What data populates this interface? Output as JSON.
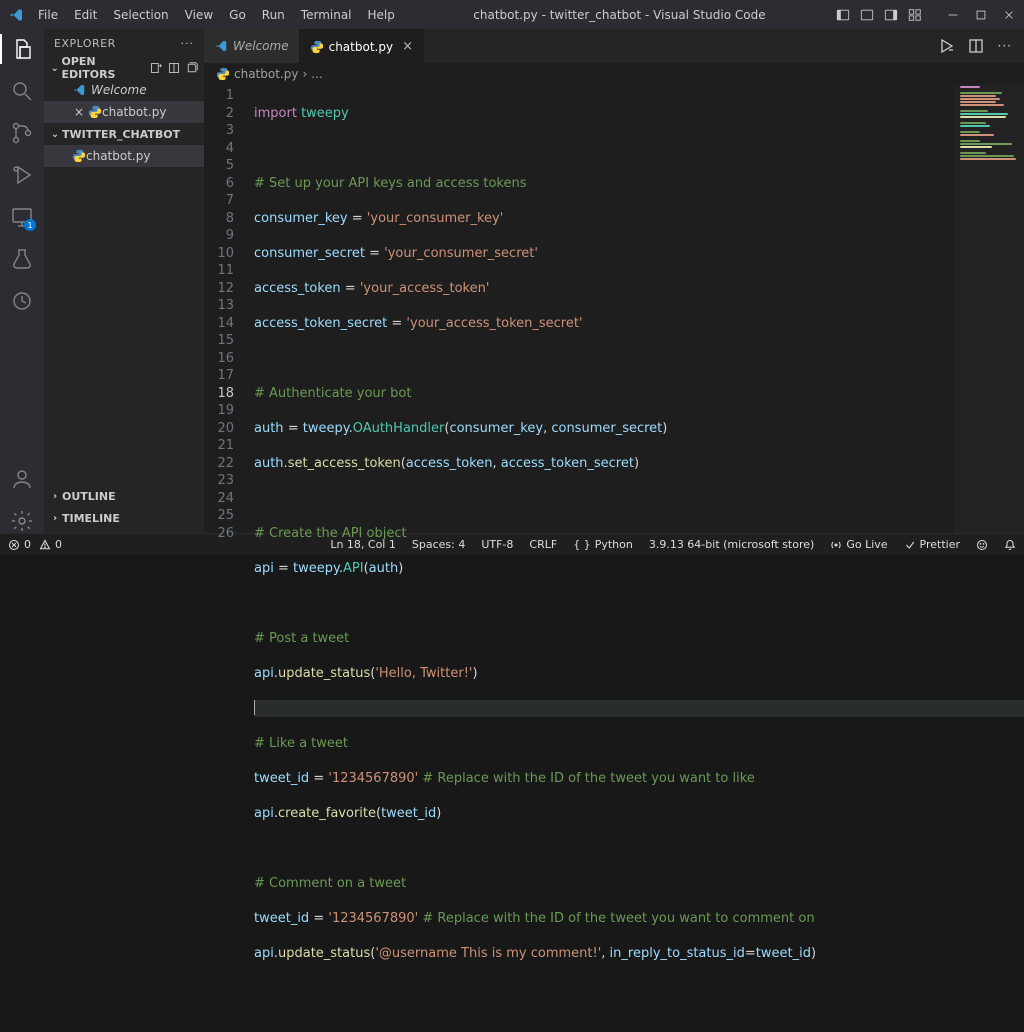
{
  "window": {
    "title": "chatbot.py - twitter_chatbot - Visual Studio Code",
    "menu": [
      "File",
      "Edit",
      "Selection",
      "View",
      "Go",
      "Run",
      "Terminal",
      "Help"
    ]
  },
  "sidebar": {
    "title": "EXPLORER",
    "openEditors": {
      "label": "OPEN EDITORS",
      "items": [
        "Welcome",
        "chatbot.py"
      ]
    },
    "workspace": {
      "name": "TWITTER_CHATBOT",
      "files": [
        "chatbot.py"
      ]
    },
    "outline": "OUTLINE",
    "timeline": "TIMELINE"
  },
  "tabs": {
    "welcome": "Welcome",
    "file": "chatbot.py"
  },
  "breadcrumb": {
    "file": "chatbot.py",
    "more": "..."
  },
  "gutter": {
    "start": 1,
    "end": 26
  },
  "code": {
    "l1_kw": "import",
    "l1_pkg": "tweepy",
    "l3": "# Set up your API keys and access tokens",
    "l4_v": "consumer_key",
    "l4_s": "'your_consumer_key'",
    "l5_v": "consumer_secret",
    "l5_s": "'your_consumer_secret'",
    "l6_v": "access_token",
    "l6_s": "'your_access_token'",
    "l7_v": "access_token_secret",
    "l7_s": "'your_access_token_secret'",
    "l9": "# Authenticate your bot",
    "l10_v": "auth",
    "l10_m": "tweepy",
    "l10_c": "OAuthHandler",
    "l10_a1": "consumer_key",
    "l10_a2": "consumer_secret",
    "l11_v": "auth",
    "l11_f": "set_access_token",
    "l11_a1": "access_token",
    "l11_a2": "access_token_secret",
    "l13": "# Create the API object",
    "l14_v": "api",
    "l14_m": "tweepy",
    "l14_c": "API",
    "l14_a": "auth",
    "l16": "# Post a tweet",
    "l17_v": "api",
    "l17_f": "update_status",
    "l17_s": "'Hello, Twitter!'",
    "l19": "# Like a tweet",
    "l20_v": "tweet_id",
    "l20_s": "'1234567890'",
    "l20_c": "# Replace with the ID of the tweet you want to like",
    "l21_v": "api",
    "l21_f": "create_favorite",
    "l21_a": "tweet_id",
    "l23": "# Comment on a tweet",
    "l24_v": "tweet_id",
    "l24_s": "'1234567890'",
    "l24_c": "# Replace with the ID of the tweet you want to comment on",
    "l25_v": "api",
    "l25_f": "update_status",
    "l25_s": "'@username This is my comment!'",
    "l25_k": "in_reply_to_status_id",
    "l25_a": "tweet_id"
  },
  "status": {
    "errors": "0",
    "warnings": "0",
    "cursor": "Ln 18, Col 1",
    "spaces": "Spaces: 4",
    "encoding": "UTF-8",
    "eol": "CRLF",
    "lang": "Python",
    "interpreter": "3.9.13 64-bit (microsoft store)",
    "golive": "Go Live",
    "prettier": "Prettier",
    "remote_badge": "1"
  }
}
